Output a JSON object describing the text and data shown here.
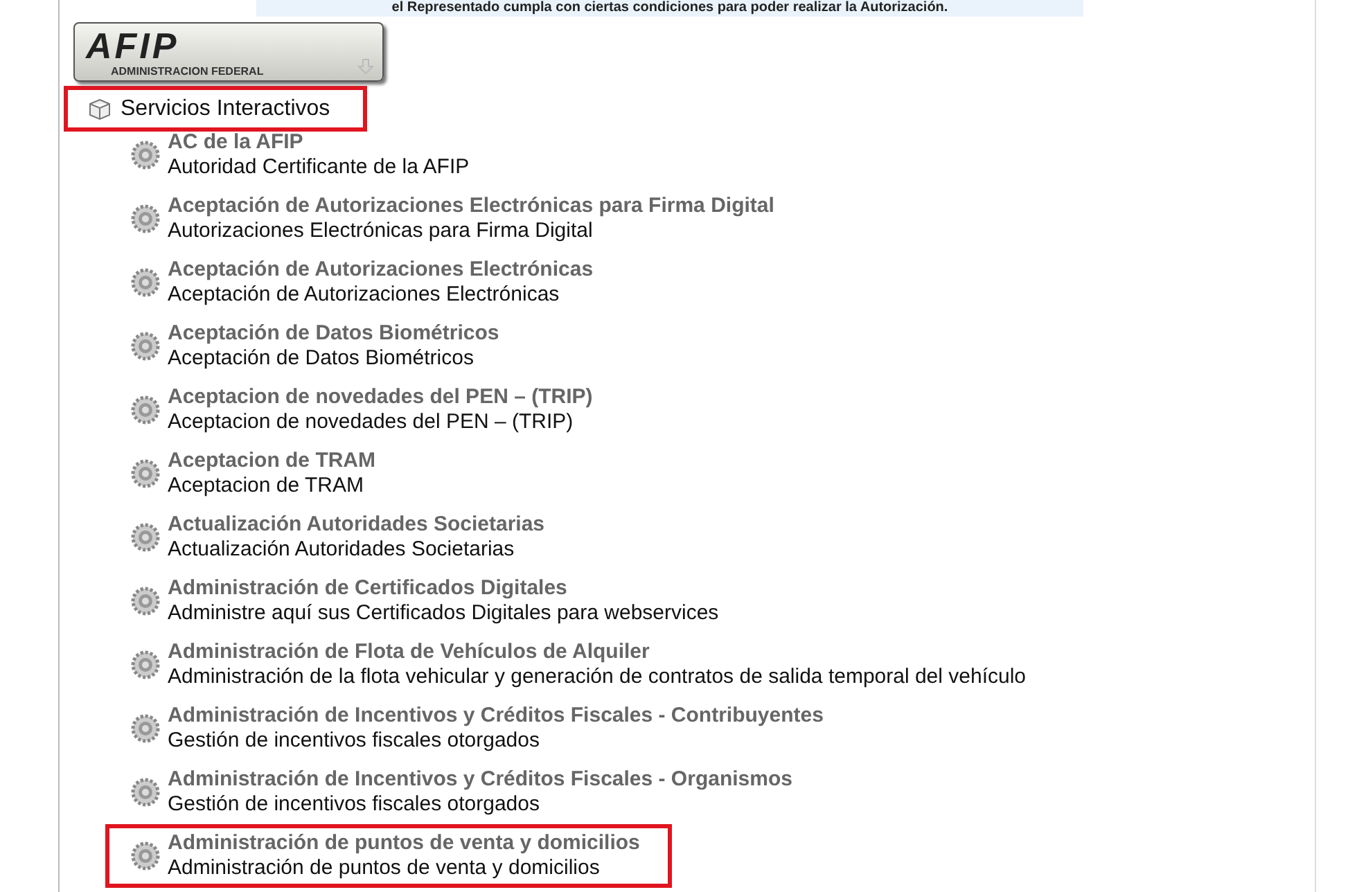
{
  "notice": "el Representado cumpla con ciertas condiciones para poder realizar la Autorización.",
  "logo": {
    "wordmark": "AFIP",
    "subtitle": "ADMINISTRACION FEDERAL"
  },
  "section": {
    "title": "Servicios Interactivos",
    "highlighted": true
  },
  "services": [
    {
      "title": "AC de la AFIP",
      "description": "Autoridad Certificante de la AFIP",
      "highlighted": false
    },
    {
      "title": "Aceptación de Autorizaciones Electrónicas para Firma Digital",
      "description": "Autorizaciones Electrónicas para Firma Digital",
      "highlighted": false
    },
    {
      "title": "Aceptación de Autorizaciones Electrónicas",
      "description": "Aceptación de Autorizaciones Electrónicas",
      "highlighted": false
    },
    {
      "title": "Aceptación de Datos Biométricos",
      "description": "Aceptación de Datos Biométricos",
      "highlighted": false
    },
    {
      "title": "Aceptacion de novedades del PEN – (TRIP)",
      "description": "Aceptacion de novedades del PEN – (TRIP)",
      "highlighted": false
    },
    {
      "title": "Aceptacion de TRAM",
      "description": "Aceptacion de TRAM",
      "highlighted": false
    },
    {
      "title": "Actualización Autoridades Societarias",
      "description": "Actualización Autoridades Societarias",
      "highlighted": false
    },
    {
      "title": "Administración de Certificados Digitales",
      "description": "Administre aquí sus Certificados Digitales para webservices",
      "highlighted": false
    },
    {
      "title": "Administración de Flota de Vehículos de Alquiler",
      "description": "Administración de la flota vehicular y generación de contratos de salida temporal del vehículo",
      "highlighted": false
    },
    {
      "title": "Administración de Incentivos y Créditos Fiscales - Contribuyentes",
      "description": "Gestión de incentivos fiscales otorgados",
      "highlighted": false
    },
    {
      "title": "Administración de Incentivos y Créditos Fiscales - Organismos",
      "description": "Gestión de incentivos fiscales otorgados",
      "highlighted": false
    },
    {
      "title": "Administración de puntos de venta y domicilios",
      "description": "Administración de puntos de venta y domicilios",
      "highlighted": true
    }
  ]
}
